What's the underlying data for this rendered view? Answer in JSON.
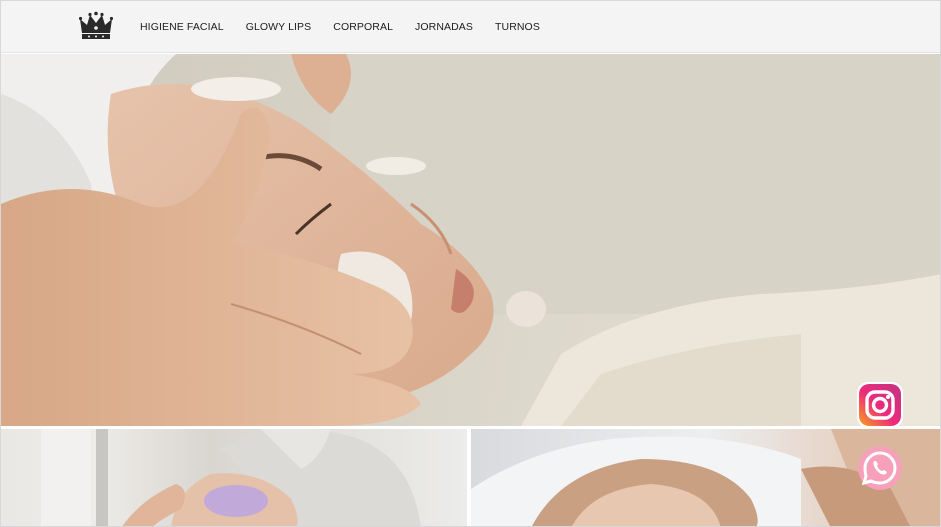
{
  "header": {
    "logo": {
      "icon": "crown-icon"
    },
    "nav": [
      {
        "label": "HIGIENE FACIAL"
      },
      {
        "label": "GLOWY LIPS"
      },
      {
        "label": "CORPORAL"
      },
      {
        "label": "JORNADAS"
      },
      {
        "label": "TURNOS"
      }
    ]
  },
  "hero": {
    "image": "facial-treatment-photo"
  },
  "tiles": [
    {
      "image": "face-mask-photo"
    },
    {
      "image": "facial-massage-photo"
    }
  ],
  "floating_buttons": [
    {
      "icon": "instagram-icon",
      "color": "#e1306c"
    },
    {
      "icon": "whatsapp-icon",
      "color": "#f48fb1"
    }
  ]
}
